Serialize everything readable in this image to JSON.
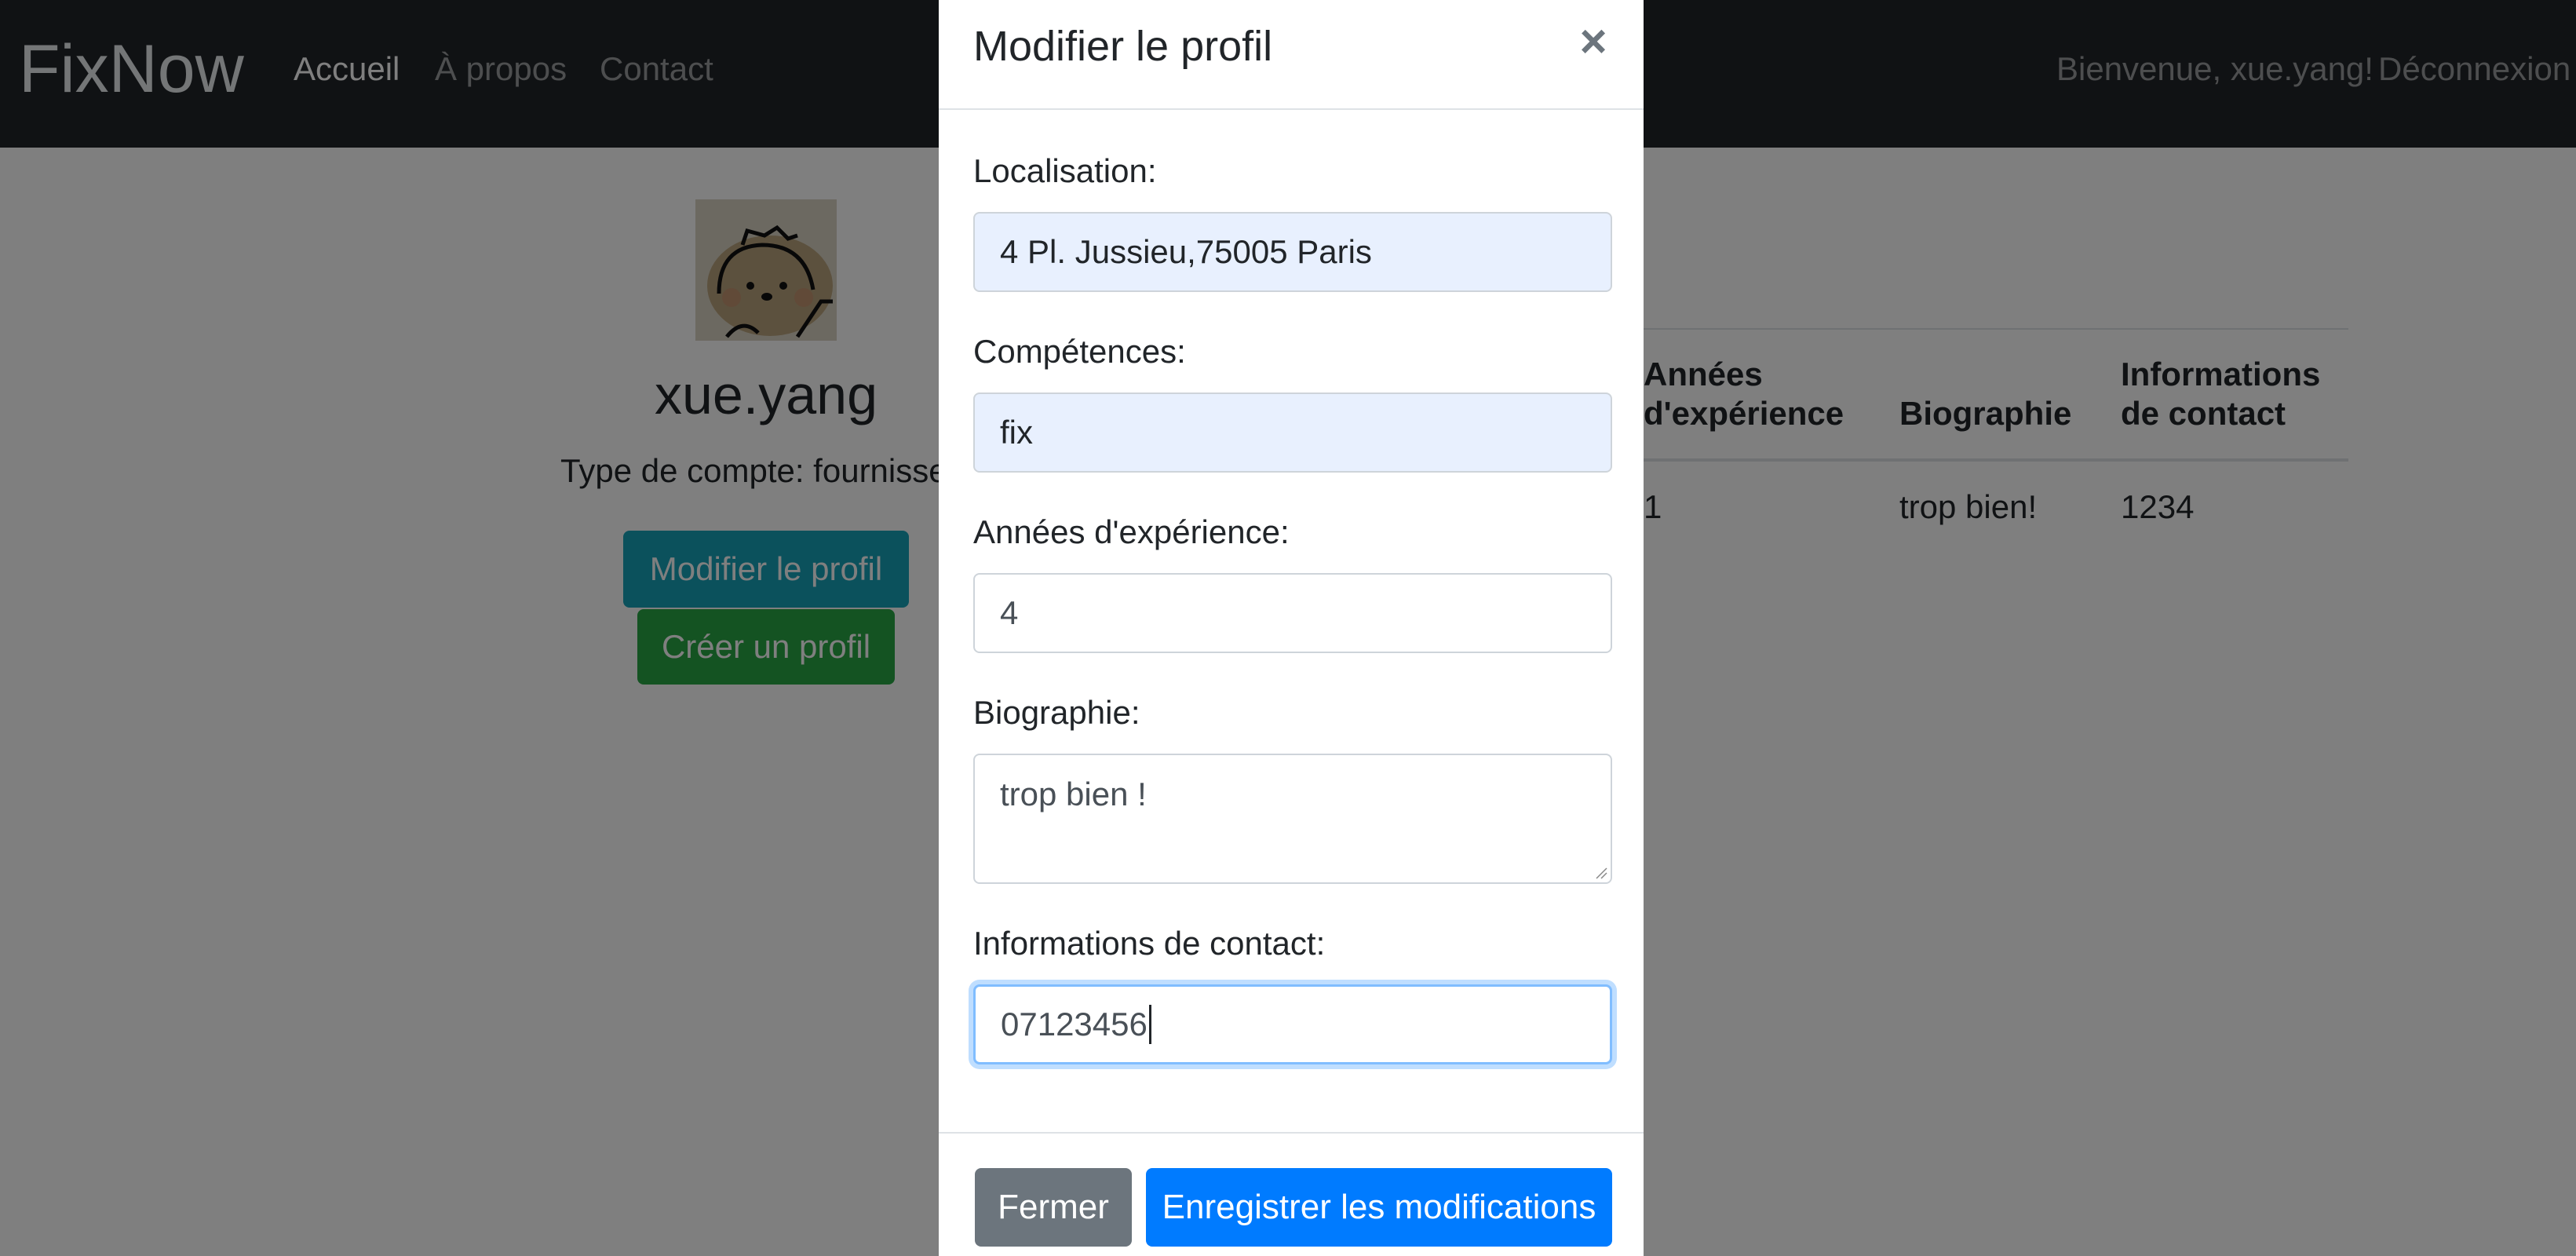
{
  "navbar": {
    "brand": "FixNow",
    "links": [
      "Accueil",
      "À propos",
      "Contact"
    ],
    "welcome": "Bienvenue, xue.yang!",
    "logout": "Déconnexion"
  },
  "profile": {
    "username": "xue.yang",
    "account_type": "Type de compte: fournisse",
    "edit_button": "Modifier le profil",
    "create_button": "Créer un profil"
  },
  "table": {
    "headers": [
      [
        "Années",
        "d'expérience"
      ],
      [
        "Biographie"
      ],
      [
        "Informations",
        "de contact"
      ]
    ],
    "row": [
      "1",
      "trop bien!",
      "1234"
    ]
  },
  "modal": {
    "title": "Modifier le profil",
    "close_glyph": "×",
    "fields": {
      "location": {
        "label": "Localisation:",
        "value": "4 Pl. Jussieu,75005 Paris"
      },
      "skills": {
        "label": "Compétences:",
        "value": "fix"
      },
      "experience": {
        "label": "Années d'expérience:",
        "value": "4"
      },
      "bio": {
        "label": "Biographie:",
        "value": "trop bien !"
      },
      "contact": {
        "label": "Informations de contact:",
        "value": "07123456"
      }
    },
    "close_button": "Fermer",
    "save_button": "Enregistrer les modifications"
  },
  "colors": {
    "navbar_bg": "#212529",
    "primary": "#007bff",
    "secondary": "#6c757d",
    "info": "#17a2b8",
    "success": "#28a745",
    "autofill_bg": "#e8f0fe"
  },
  "icons": {
    "close": "close-icon",
    "avatar": "avatar-cartoon-bear"
  }
}
